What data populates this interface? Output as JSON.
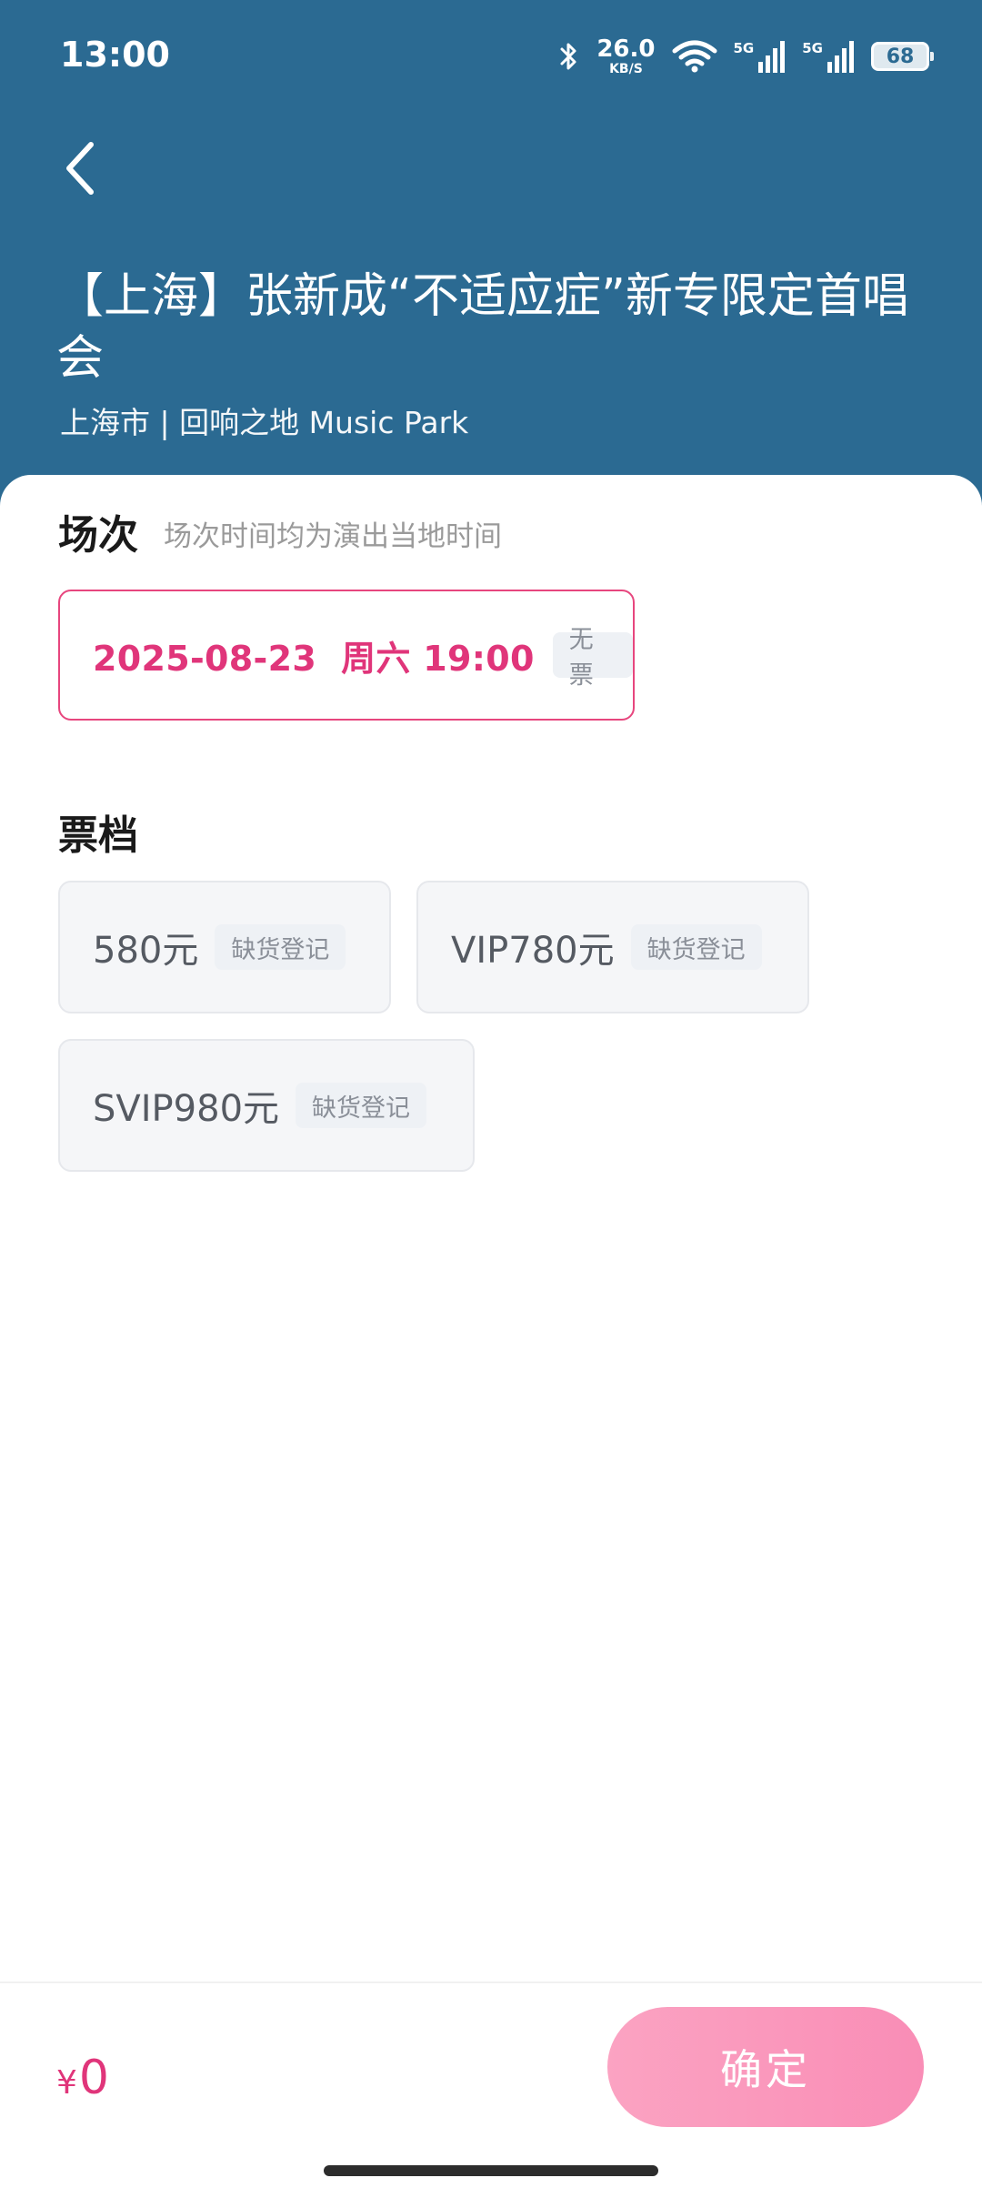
{
  "status_bar": {
    "time": "13:00",
    "net_speed_value": "26.0",
    "net_speed_unit": "KB/S",
    "sim1_label": "5G",
    "sim2_label": "5G",
    "battery": "68"
  },
  "header": {
    "title": "【上海】张新成“不适应症”新专限定首唱会",
    "venue": "上海市 | 回响之地 Music Park"
  },
  "session": {
    "heading": "场次",
    "note": "场次时间均为演出当地时间",
    "option": {
      "label": "2025-08-23  周六 19:00",
      "status": "无票"
    }
  },
  "tiers": {
    "heading": "票档",
    "items": [
      {
        "price": "580元",
        "status": "缺货登记"
      },
      {
        "price": "VIP780元",
        "status": "缺货登记"
      },
      {
        "price": "SVIP980元",
        "status": "缺货登记"
      }
    ]
  },
  "footer": {
    "currency": "¥",
    "total": "0",
    "confirm_label": "确定"
  },
  "colors": {
    "header_bg": "#2B6A92",
    "accent": "#E0357A",
    "confirm_bg": "#F98DB6",
    "tag_bg": "#EEF1F5"
  },
  "icons": [
    "bluetooth-icon",
    "wifi-icon",
    "signal-icon",
    "battery-icon",
    "back-arrow-icon"
  ]
}
